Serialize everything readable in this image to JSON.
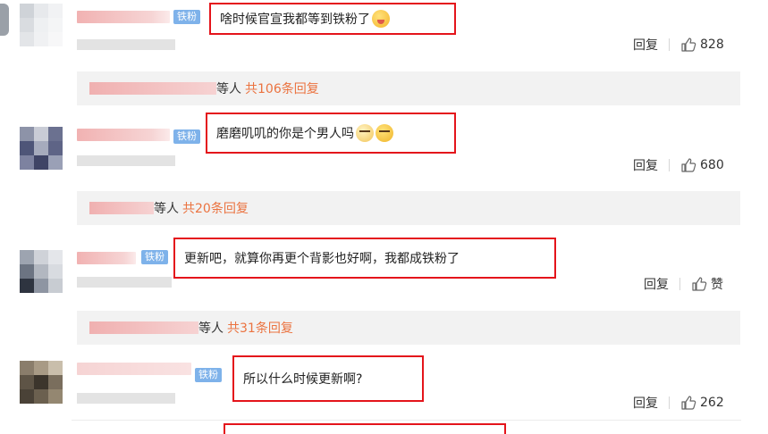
{
  "badge_label": "铁粉",
  "reply_label": "回复",
  "comments": [
    {
      "text": "啥时候官宣我都等到铁粉了",
      "likes": "828",
      "replies_suffix": "等人",
      "replies_count": "共106条回复"
    },
    {
      "text": "磨磨叽叽的你是个男人吗",
      "likes": "680",
      "replies_suffix": "等人",
      "replies_count": "共20条回复"
    },
    {
      "text": "更新吧，就算你再更个背影也好啊，我都成铁粉了",
      "likes": "赞",
      "replies_suffix": "等人",
      "replies_count": "共31条回复"
    },
    {
      "text": "所以什么时候更新啊?",
      "likes": "262"
    }
  ],
  "colors": {
    "highlight_border": "#e4141b",
    "reply_count": "#eb7340",
    "badge_bg": "#7eb2ea"
  },
  "icons": {
    "like": "thumbs-up-icon",
    "emoji": "emoji-icon"
  }
}
